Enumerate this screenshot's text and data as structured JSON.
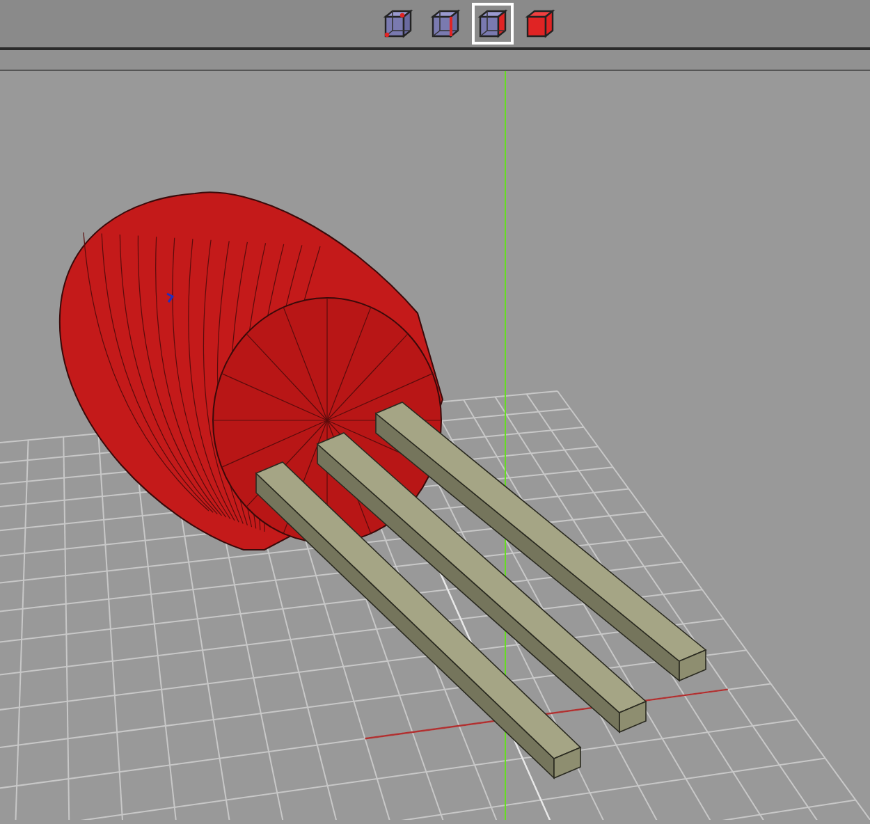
{
  "toolbar": {
    "selection_modes": [
      {
        "kind": "vertex",
        "selected": false
      },
      {
        "kind": "edge",
        "selected": false
      },
      {
        "kind": "face",
        "selected": true
      },
      {
        "kind": "object",
        "selected": false
      }
    ]
  }
}
